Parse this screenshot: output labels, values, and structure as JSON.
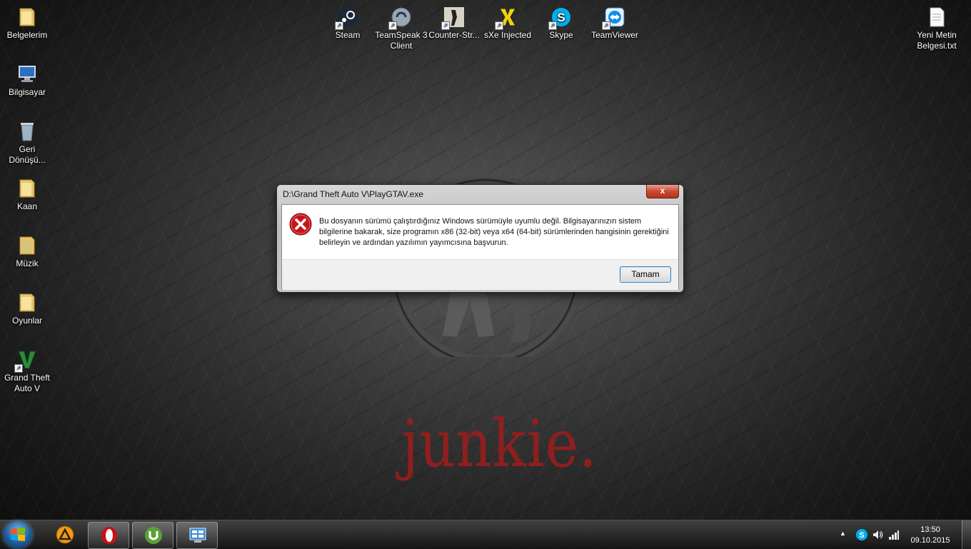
{
  "desktop": {
    "left_icons": [
      {
        "label": "Belgelerim"
      },
      {
        "label": "Bilgisayar"
      },
      {
        "label": "Geri Dönüşü..."
      },
      {
        "label": "Kaan"
      },
      {
        "label": "Müzik"
      },
      {
        "label": "Oyunlar"
      },
      {
        "label": "Grand Theft Auto V"
      }
    ],
    "top_icons": [
      {
        "label": "Steam"
      },
      {
        "label": "TeamSpeak 3 Client"
      },
      {
        "label": "Counter-Str..."
      },
      {
        "label": "sXe Injected"
      },
      {
        "label": "Skype"
      },
      {
        "label": "TeamViewer"
      }
    ],
    "right_icons": [
      {
        "label": "Yeni Metin Belgesi.txt"
      }
    ],
    "wallpaper_text": "junkie."
  },
  "dialog": {
    "title": "D:\\Grand Theft Auto V\\PlayGTAV.exe",
    "close_label": "x",
    "message": "Bu dosyanın sürümü çalıştırdığınız Windows sürümüyle uyumlu değil. Bilgisayarınızın sistem bilgilerine bakarak, size programın x86 (32-bit) veya x64 (64-bit) sürümlerinden hangisinin gerektiğini belirleyin ve ardından yazılımın yayımcısına başvurun.",
    "ok_label": "Tamam"
  },
  "taskbar": {
    "tray_arrow": "▲",
    "time": "13:50",
    "date": "09.10.2015"
  },
  "colors": {
    "wallpaper_text": "#9b1d1d",
    "error_red": "#c4161c",
    "button_border": "#3c7fb1"
  }
}
